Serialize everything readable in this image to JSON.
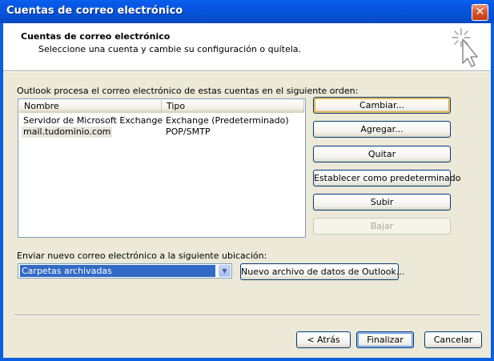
{
  "window": {
    "title": "Cuentas de correo electrónico",
    "close_glyph": "✕"
  },
  "header": {
    "title": "Cuentas de correo electrónico",
    "subtitle": "Seleccione una cuenta y cambie su configuración o quítela.",
    "icon": "sparkle-cursor-icon"
  },
  "accounts": {
    "label": "Outlook procesa el correo electrónico de estas cuentas en el siguiente orden:",
    "columns": [
      "Nombre",
      "Tipo"
    ],
    "rows": [
      {
        "name": "Servidor de Microsoft Exchange",
        "type": "Exchange (Predeterminado)"
      },
      {
        "name": "mail.tudominio.com",
        "type": "POP/SMTP"
      }
    ]
  },
  "buttons": {
    "change": "Cambiar...",
    "add": "Agregar...",
    "remove": "Quitar",
    "set_default": "Establecer como predeterminado",
    "up": "Subir",
    "down": "Bajar"
  },
  "delivery": {
    "label": "Enviar nuevo correo electrónico a la siguiente ubicación:",
    "selected": "Carpetas archivadas",
    "new_data_file": "Nuevo archivo de datos de Outlook..."
  },
  "footer": {
    "back": "< Atrás",
    "finish": "Finalizar",
    "cancel": "Cancelar"
  },
  "colors": {
    "title_bar": "#0553d8",
    "dialog_face": "#ece9d8",
    "selection": "#316ac5"
  }
}
